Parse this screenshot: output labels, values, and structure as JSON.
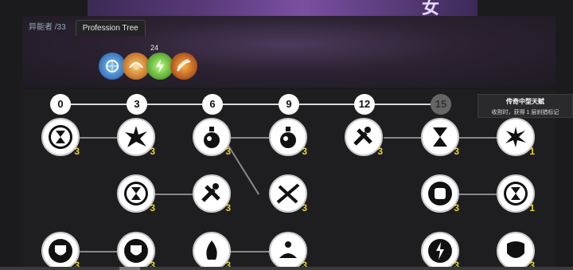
{
  "banner": {
    "title": "女导... 船长"
  },
  "tabs": [
    {
      "label": "异能者 /33"
    },
    {
      "label": "Profession Tree"
    }
  ],
  "skills": {
    "count": "24",
    "icons": [
      "frost-orb-icon",
      "fire-burst-icon",
      "green-bolt-icon",
      "fire-slash-icon"
    ]
  },
  "levels": [
    "0",
    "3",
    "6",
    "9",
    "12",
    "15"
  ],
  "tooltip": {
    "title": "传奇中型天赋",
    "desc": "收割时，获得 1 层刹猎标记"
  },
  "nodes": [
    {
      "icon": "hourglass-icon",
      "rank": "3"
    },
    {
      "icon": "shatter-icon",
      "rank": "3"
    },
    {
      "icon": "potion-flask-icon",
      "rank": "3"
    },
    {
      "icon": "potion-flask-icon",
      "rank": "3"
    },
    {
      "icon": "hammer-tools-icon",
      "rank": "3"
    },
    {
      "icon": "hourglass-timer-icon",
      "rank": "3"
    },
    {
      "icon": "explosion-icon",
      "rank": "1"
    },
    {
      "icon": "hourglass-icon",
      "rank": "3"
    },
    {
      "icon": "hammer-tools-icon",
      "rank": "3"
    },
    {
      "icon": "crossed-blades-icon",
      "rank": "3"
    },
    {
      "icon": "fist-burst-icon",
      "rank": "3"
    },
    {
      "icon": "hourglass-icon",
      "rank": "1"
    },
    {
      "icon": "shield-ring-icon",
      "rank": "3"
    },
    {
      "icon": "shield-ring-icon",
      "rank": "3"
    },
    {
      "icon": "flame-icon",
      "rank": "3"
    },
    {
      "icon": "meditation-icon",
      "rank": "3"
    },
    {
      "icon": "lightning-snow-icon",
      "rank": "3"
    },
    {
      "icon": "claw-shield-icon",
      "rank": "3"
    }
  ]
}
